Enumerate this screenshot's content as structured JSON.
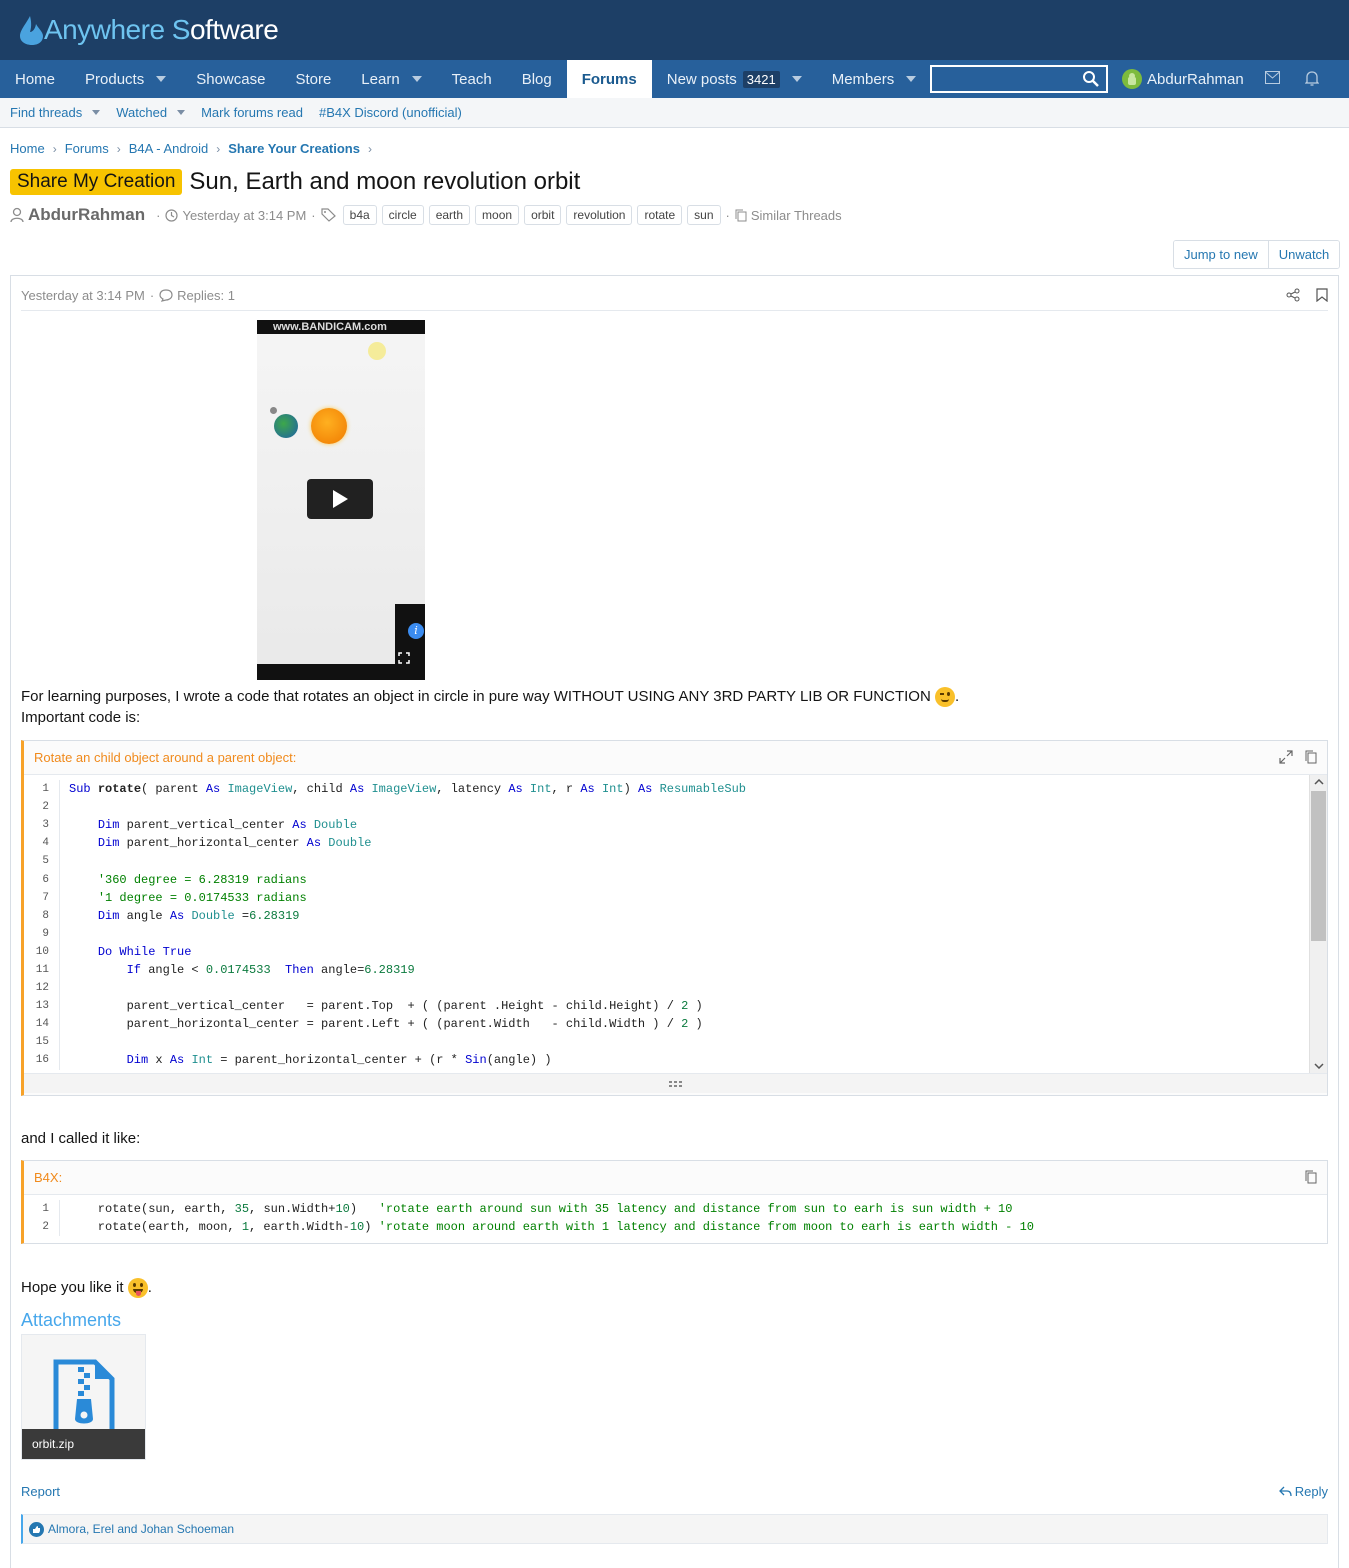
{
  "header": {
    "logo_part1": "Anywhere ",
    "logo_part2": "S",
    "logo_part3": "oftware"
  },
  "nav": {
    "items": [
      "Home",
      "Products",
      "Showcase",
      "Store",
      "Learn",
      "Teach",
      "Blog",
      "Forums",
      "New posts",
      "Members"
    ],
    "new_posts_count": "3421",
    "search_placeholder": "",
    "username": "AbdurRahman"
  },
  "subnav": {
    "find_threads": "Find threads",
    "watched": "Watched",
    "mark_read": "Mark forums read",
    "discord": "#B4X Discord (unofficial)"
  },
  "breadcrumb": [
    "Home",
    "Forums",
    "B4A - Android",
    "Share Your Creations"
  ],
  "thread": {
    "prefix": "Share My Creation",
    "title": "Sun, Earth and moon revolution orbit",
    "author": "AbdurRahman",
    "date": "Yesterday at 3:14 PM",
    "tags": [
      "b4a",
      "circle",
      "earth",
      "moon",
      "orbit",
      "revolution",
      "rotate",
      "sun"
    ],
    "similar": "Similar Threads",
    "jump_to_new": "Jump to new",
    "unwatch": "Unwatch"
  },
  "post": {
    "date": "Yesterday at 3:14 PM",
    "replies": "Replies: 1",
    "video_watermark": "www.BANDICAM.com",
    "para1": "For learning purposes, I wrote a code that rotates an object in circle in pure way WITHOUT USING ANY 3RD PARTY LIB OR FUNCTION",
    "para1_end": ".",
    "para2": "Important code is:",
    "code1_title": "Rotate an child object around a parent object:",
    "code1_line_numbers": [
      "1",
      "2",
      "3",
      "4",
      "5",
      "6",
      "7",
      "8",
      "9",
      "10",
      "11",
      "12",
      "13",
      "14",
      "15",
      "16"
    ],
    "para3": "and I called it like:",
    "code2_title": "B4X:",
    "code2_line_numbers": [
      "1",
      "2"
    ],
    "para4": "Hope you like it",
    "para4_end": ".",
    "attachments_title": "Attachments",
    "attachment_name": "orbit.zip",
    "report": "Report",
    "reply": "Reply",
    "reactions": "Almora, Erel and Johan Schoeman"
  },
  "colors": {
    "header_bg": "#1d3f66",
    "nav_bg": "#27609b",
    "prefix_bg": "#f7c300",
    "link": "#2577b1",
    "code_accent": "#f7a229"
  }
}
